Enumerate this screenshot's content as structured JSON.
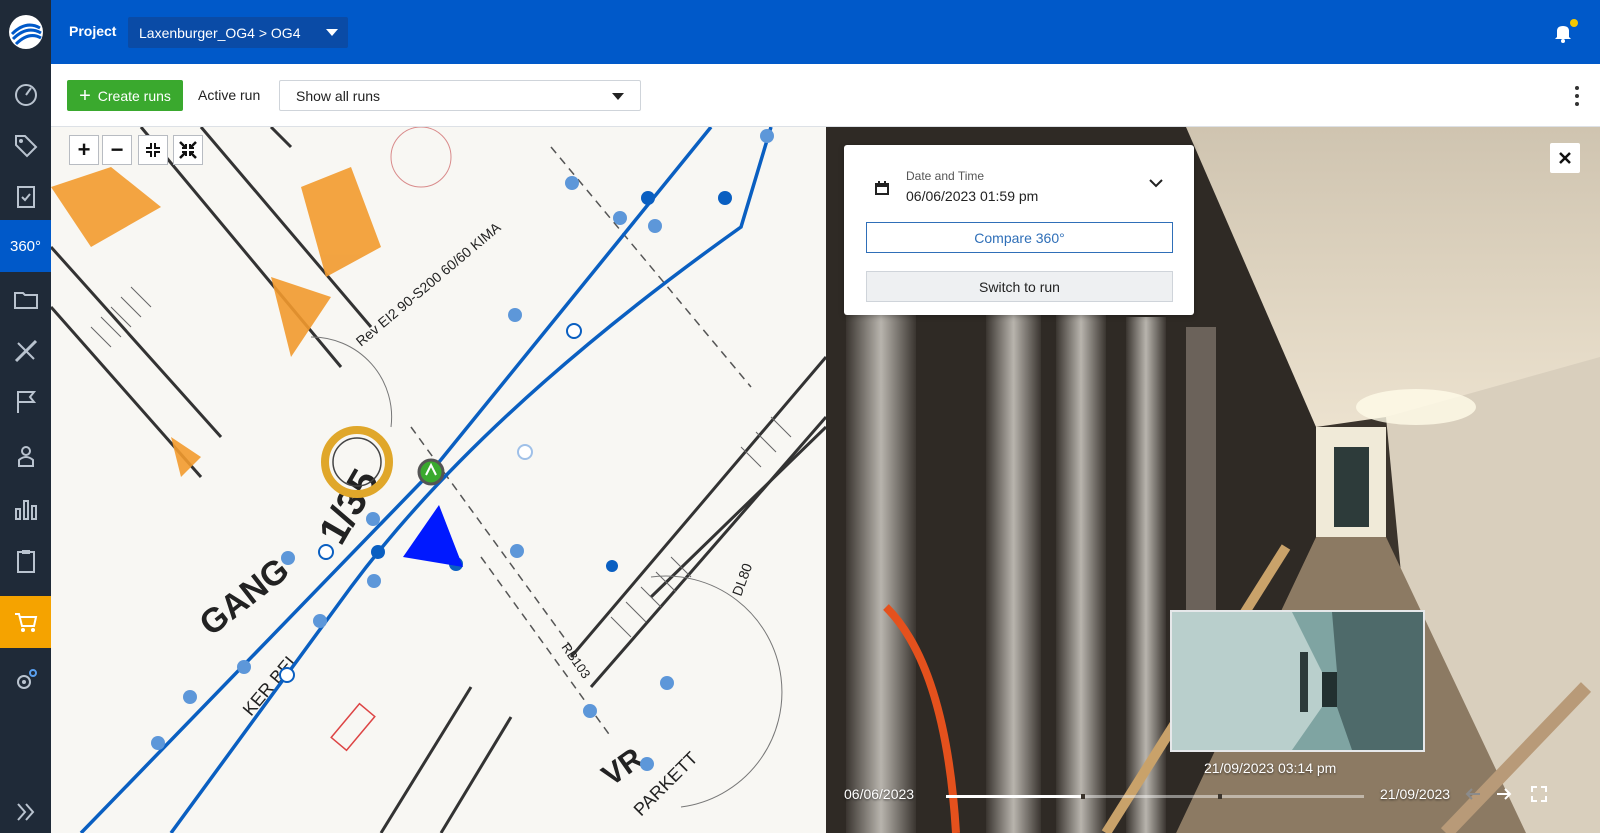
{
  "header": {
    "project_label": "Project",
    "project_path": "Laxenburger_OG4 > OG4"
  },
  "sidebar": {
    "items": [
      {
        "name": "dashboard",
        "icon": "gauge-icon"
      },
      {
        "name": "tags",
        "icon": "tag-icon"
      },
      {
        "name": "reports",
        "icon": "clipboard-check-icon"
      },
      {
        "name": "360",
        "label": "360°",
        "active": true
      },
      {
        "name": "files",
        "icon": "folder-icon"
      },
      {
        "name": "measure",
        "icon": "ruler-pencil-icon"
      },
      {
        "name": "flags",
        "icon": "flag-icon"
      },
      {
        "name": "users",
        "icon": "person-icon"
      },
      {
        "name": "analytics",
        "icon": "bar-chart-icon"
      },
      {
        "name": "tasks",
        "icon": "clipboard-icon"
      },
      {
        "name": "shop",
        "icon": "cart-icon",
        "highlight": true
      },
      {
        "name": "settings",
        "icon": "gear-icon"
      },
      {
        "name": "expand",
        "icon": "double-chevron-right-icon"
      }
    ]
  },
  "toolbar": {
    "create_runs_label": "Create runs",
    "active_run_label": "Active run",
    "run_select_value": "Show all runs"
  },
  "map": {
    "zoom_in": "+",
    "zoom_out": "−"
  },
  "viewer": {
    "datetime_label": "Date and Time",
    "datetime_value": "06/06/2023 01:59 pm",
    "compare_label": "Compare 360°",
    "switch_label": "Switch to run",
    "thumbnail_date": "21/09/2023 03:14 pm",
    "timeline_start": "06/06/2023",
    "timeline_end": "21/09/2023",
    "timeline_progress": 0.33
  },
  "colors": {
    "brand_blue": "#0059c9",
    "sidebar_bg": "#1f2a38",
    "create_green": "#3aa92e",
    "cart_orange": "#f5a300",
    "route_blue": "#0a5fc1"
  }
}
